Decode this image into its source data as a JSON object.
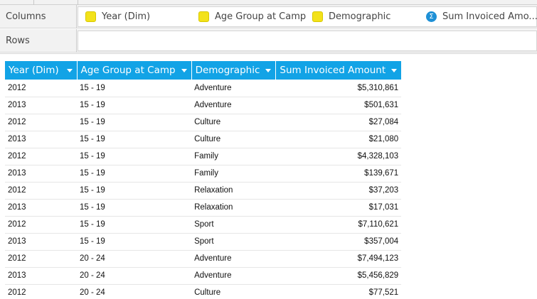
{
  "shelves": {
    "columns_label": "Columns",
    "rows_label": "Rows",
    "column_chips": [
      {
        "label": "Year (Dim)",
        "icon": "dimension-marker-icon"
      },
      {
        "label": "Age Group at Camp",
        "icon": "dimension-marker-icon"
      },
      {
        "label": "Demographic",
        "icon": "dimension-marker-icon"
      },
      {
        "label": "Sum Invoiced Amo...",
        "icon": "sigma-measure-icon"
      }
    ]
  },
  "colors": {
    "header_bg": "#12a3e6",
    "dimension_marker": "#f3e21a",
    "measure_icon": "#1e90d6"
  },
  "table": {
    "headers": [
      "Year (Dim)",
      "Age Group at Camp",
      "Demographic",
      "Sum Invoiced Amount"
    ],
    "rows": [
      [
        "2012",
        "15 - 19",
        "Adventure",
        "$5,310,861"
      ],
      [
        "2013",
        "15 - 19",
        "Adventure",
        "$501,631"
      ],
      [
        "2012",
        "15 - 19",
        "Culture",
        "$27,084"
      ],
      [
        "2013",
        "15 - 19",
        "Culture",
        "$21,080"
      ],
      [
        "2012",
        "15 - 19",
        "Family",
        "$4,328,103"
      ],
      [
        "2013",
        "15 - 19",
        "Family",
        "$139,671"
      ],
      [
        "2012",
        "15 - 19",
        "Relaxation",
        "$37,203"
      ],
      [
        "2013",
        "15 - 19",
        "Relaxation",
        "$17,031"
      ],
      [
        "2012",
        "15 - 19",
        "Sport",
        "$7,110,621"
      ],
      [
        "2013",
        "15 - 19",
        "Sport",
        "$357,004"
      ],
      [
        "2012",
        "20 - 24",
        "Adventure",
        "$7,494,123"
      ],
      [
        "2013",
        "20 - 24",
        "Adventure",
        "$5,456,829"
      ],
      [
        "2012",
        "20 - 24",
        "Culture",
        "$77,521"
      ]
    ]
  }
}
